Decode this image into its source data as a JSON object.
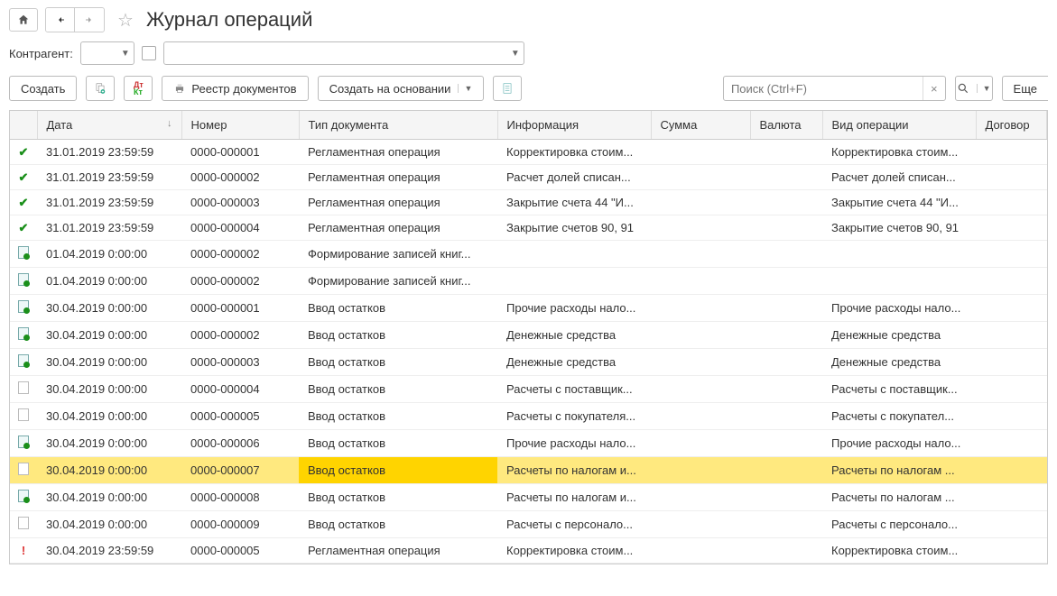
{
  "title": "Журнал операций",
  "filter": {
    "label": "Контрагент:"
  },
  "toolbar": {
    "create": "Создать",
    "registry": "Реестр документов",
    "create_based": "Создать на основании",
    "more": "Еще"
  },
  "search": {
    "placeholder": "Поиск (Ctrl+F)"
  },
  "columns": {
    "date": "Дата",
    "number": "Номер",
    "doc_type": "Тип документа",
    "info": "Информация",
    "sum": "Сумма",
    "currency": "Валюта",
    "op_type": "Вид операции",
    "contract": "Договор"
  },
  "rows": [
    {
      "icon": "check",
      "date": "31.01.2019 23:59:59",
      "number": "0000-000001",
      "doc": "Регламентная операция",
      "info": "Корректировка стоим...",
      "sum": "",
      "cur": "",
      "op": "Корректировка стоим...",
      "sel": false
    },
    {
      "icon": "check",
      "date": "31.01.2019 23:59:59",
      "number": "0000-000002",
      "doc": "Регламентная операция",
      "info": "Расчет долей списан...",
      "sum": "",
      "cur": "",
      "op": "Расчет долей списан...",
      "sel": false
    },
    {
      "icon": "check",
      "date": "31.01.2019 23:59:59",
      "number": "0000-000003",
      "doc": "Регламентная операция",
      "info": "Закрытие счета 44 \"И...",
      "sum": "",
      "cur": "",
      "op": "Закрытие счета 44 \"И...",
      "sel": false
    },
    {
      "icon": "check",
      "date": "31.01.2019 23:59:59",
      "number": "0000-000004",
      "doc": "Регламентная операция",
      "info": "Закрытие счетов 90, 91",
      "sum": "",
      "cur": "",
      "op": "Закрытие счетов 90, 91",
      "sel": false
    },
    {
      "icon": "doc-posted",
      "date": "01.04.2019 0:00:00",
      "number": "0000-000002",
      "doc": "Формирование записей книг...",
      "info": "",
      "sum": "",
      "cur": "",
      "op": "",
      "sel": false
    },
    {
      "icon": "doc-posted",
      "date": "01.04.2019 0:00:00",
      "number": "0000-000002",
      "doc": "Формирование записей книг...",
      "info": "",
      "sum": "",
      "cur": "",
      "op": "",
      "sel": false
    },
    {
      "icon": "doc-posted",
      "date": "30.04.2019 0:00:00",
      "number": "0000-000001",
      "doc": "Ввод остатков",
      "info": "Прочие расходы нало...",
      "sum": "",
      "cur": "",
      "op": "Прочие расходы нало...",
      "sel": false
    },
    {
      "icon": "doc-posted",
      "date": "30.04.2019 0:00:00",
      "number": "0000-000002",
      "doc": "Ввод остатков",
      "info": "Денежные средства",
      "sum": "",
      "cur": "",
      "op": "Денежные средства",
      "sel": false
    },
    {
      "icon": "doc-posted",
      "date": "30.04.2019 0:00:00",
      "number": "0000-000003",
      "doc": "Ввод остатков",
      "info": "Денежные средства",
      "sum": "",
      "cur": "",
      "op": "Денежные средства",
      "sel": false
    },
    {
      "icon": "page",
      "date": "30.04.2019 0:00:00",
      "number": "0000-000004",
      "doc": "Ввод остатков",
      "info": "Расчеты с поставщик...",
      "sum": "",
      "cur": "",
      "op": "Расчеты с поставщик...",
      "sel": false
    },
    {
      "icon": "page",
      "date": "30.04.2019 0:00:00",
      "number": "0000-000005",
      "doc": "Ввод остатков",
      "info": "Расчеты с покупателя...",
      "sum": "",
      "cur": "",
      "op": "Расчеты с покупател...",
      "sel": false
    },
    {
      "icon": "doc-posted",
      "date": "30.04.2019 0:00:00",
      "number": "0000-000006",
      "doc": "Ввод остатков",
      "info": "Прочие расходы нало...",
      "sum": "",
      "cur": "",
      "op": "Прочие расходы нало...",
      "sel": false
    },
    {
      "icon": "page",
      "date": "30.04.2019 0:00:00",
      "number": "0000-000007",
      "doc": "Ввод остатков",
      "info": "Расчеты по налогам и...",
      "sum": "",
      "cur": "",
      "op": "Расчеты по налогам ...",
      "sel": true
    },
    {
      "icon": "doc-posted",
      "date": "30.04.2019 0:00:00",
      "number": "0000-000008",
      "doc": "Ввод остатков",
      "info": "Расчеты по налогам и...",
      "sum": "",
      "cur": "",
      "op": "Расчеты по налогам ...",
      "sel": false
    },
    {
      "icon": "page",
      "date": "30.04.2019 0:00:00",
      "number": "0000-000009",
      "doc": "Ввод остатков",
      "info": "Расчеты с персонало...",
      "sum": "",
      "cur": "",
      "op": "Расчеты с персонало...",
      "sel": false
    },
    {
      "icon": "excl",
      "date": "30.04.2019 23:59:59",
      "number": "0000-000005",
      "doc": "Регламентная операция",
      "info": "Корректировка стоим...",
      "sum": "",
      "cur": "",
      "op": "Корректировка стоим...",
      "sel": false
    }
  ]
}
